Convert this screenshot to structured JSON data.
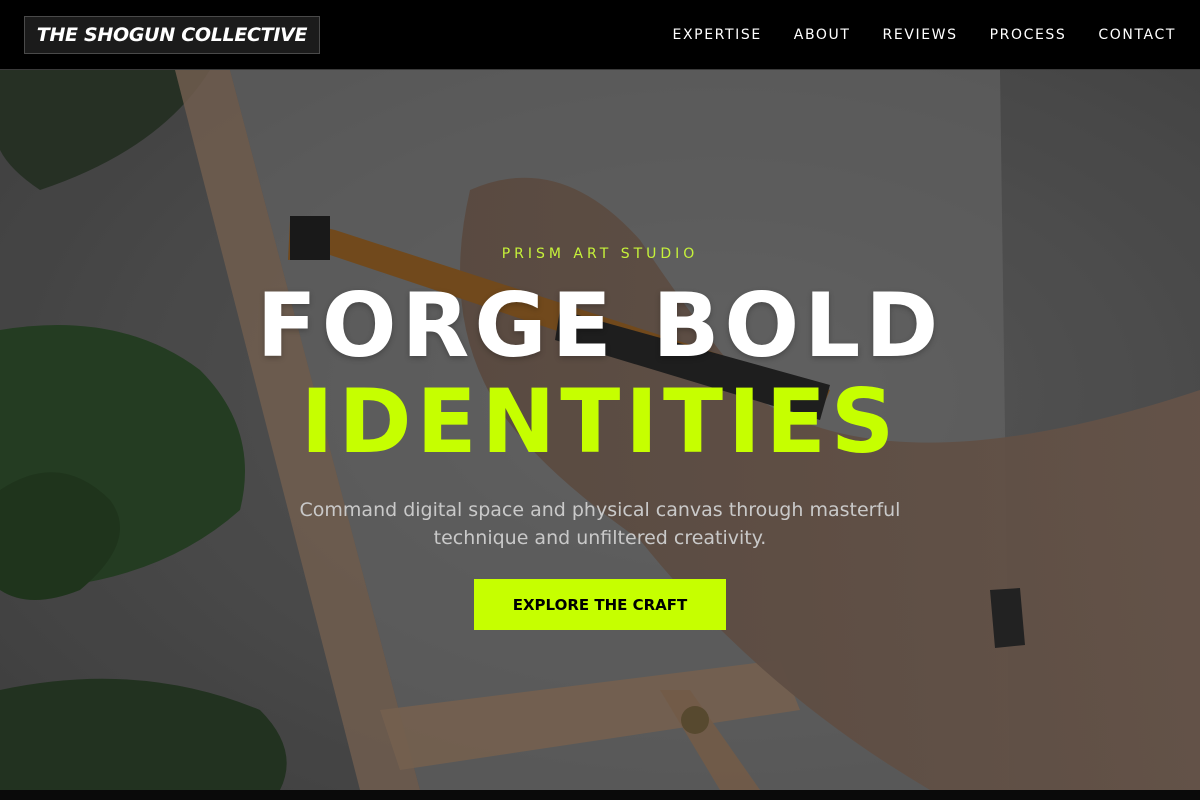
{
  "brand": {
    "name": "THE SHOGUN COLLECTIVE"
  },
  "nav": {
    "links": [
      "EXPERTISE",
      "ABOUT",
      "REVIEWS",
      "PROCESS",
      "CONTACT"
    ]
  },
  "hero": {
    "kicker": "PRISM ART STUDIO",
    "headline_line1": "FORGE BOLD",
    "headline_line2": "IDENTITIES",
    "subtitle": "Command digital space and physical canvas through masterful technique and unfiltered creativity.",
    "cta_label": "EXPLORE THE CRAFT",
    "background_image": "artist-painting-canvas-on-easel-photo"
  },
  "colors": {
    "accent": "#c6ff00",
    "nav_background": "#000000",
    "text_primary": "#ffffff",
    "text_muted": "#c9c9c9"
  }
}
